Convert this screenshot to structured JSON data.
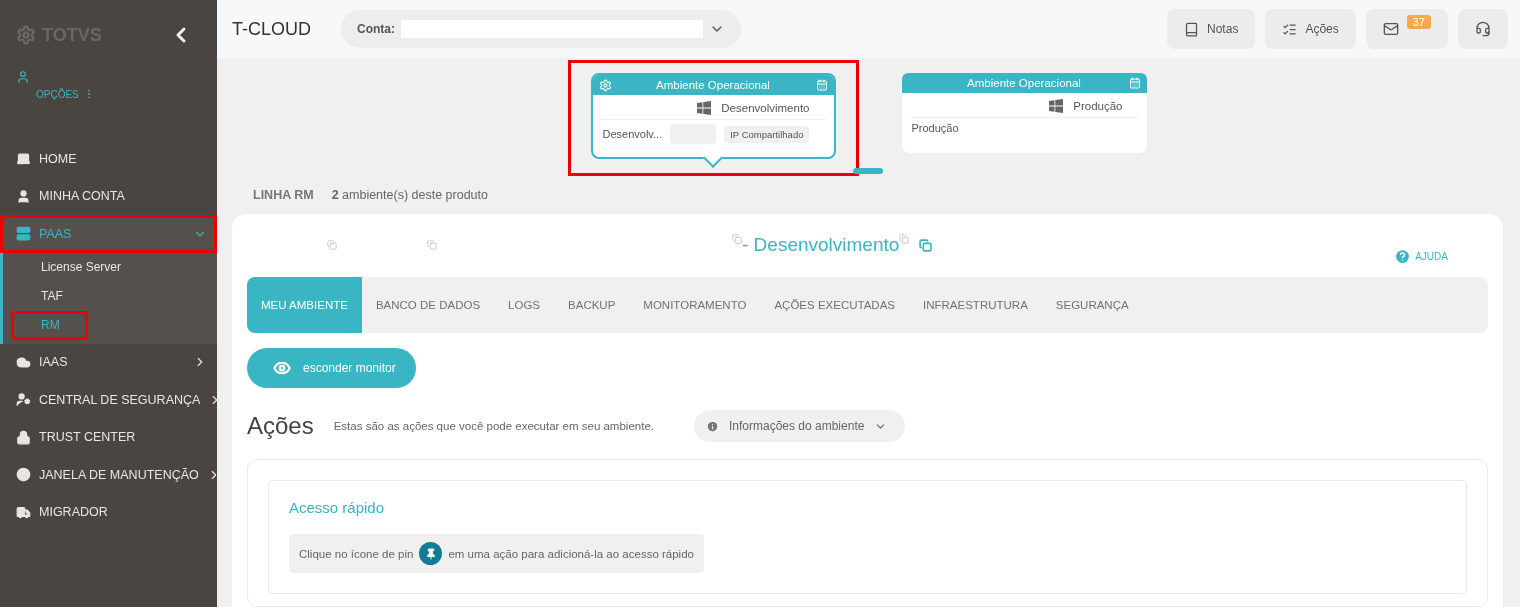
{
  "sidebar": {
    "logo": "TOTVS",
    "options_label": "OPÇÕES",
    "items": [
      {
        "label": "HOME",
        "expandable": false,
        "expanded": false,
        "highlighted": false
      },
      {
        "label": "MINHA CONTA",
        "expandable": false,
        "expanded": false,
        "highlighted": false
      },
      {
        "label": "PAAS",
        "expandable": true,
        "expanded": true,
        "highlighted": true,
        "children": [
          {
            "label": "License Server",
            "selected": false,
            "highlighted": false
          },
          {
            "label": "TAF",
            "selected": false,
            "highlighted": false
          },
          {
            "label": "RM",
            "selected": true,
            "highlighted": true
          }
        ]
      },
      {
        "label": "IAAS",
        "expandable": true,
        "expanded": false,
        "highlighted": false
      },
      {
        "label": "CENTRAL DE SEGURANÇA",
        "expandable": true,
        "expanded": false,
        "highlighted": false
      },
      {
        "label": "TRUST CENTER",
        "expandable": false,
        "expanded": false,
        "highlighted": false
      },
      {
        "label": "JANELA DE MANUTENÇÃO",
        "expandable": true,
        "expanded": false,
        "highlighted": false
      },
      {
        "label": "MIGRADOR",
        "expandable": false,
        "expanded": false,
        "highlighted": false
      }
    ]
  },
  "topbar": {
    "title": "T-CLOUD",
    "account_label": "Conta:",
    "notes": "Notas",
    "actions": "Ações",
    "messages_badge": "37"
  },
  "env_cards": [
    {
      "title": "Ambiente Operacional",
      "name": "Desenvolvimento",
      "detail": "Desenvolv...",
      "ip_label": "IP Compartilhado",
      "selected": true,
      "highlighted": true
    },
    {
      "title": "Ambiente Operacional",
      "name": "Produção",
      "detail": "Produção",
      "selected": false,
      "highlighted": false
    }
  ],
  "product": {
    "line": "LINHA RM",
    "summary": "**2** ambiente(s) deste produto"
  },
  "panel": {
    "title": "- Desenvolvimento",
    "help": "AJUDA",
    "tabs": [
      {
        "label": "MEU AMBIENTE",
        "selected": true
      },
      {
        "label": "BANCO DE DADOS",
        "selected": false
      },
      {
        "label": "LOGS",
        "selected": false
      },
      {
        "label": "BACKUP",
        "selected": false
      },
      {
        "label": "MONITORAMENTO",
        "selected": false
      },
      {
        "label": "AÇÕES EXECUTADAS",
        "selected": false
      },
      {
        "label": "INFRAESTRUTURA",
        "selected": false
      },
      {
        "label": "SEGURANÇA",
        "selected": false
      }
    ],
    "monitor_button": "esconder monitor",
    "actions_title": "Ações",
    "actions_description": "Estas são as ações que você pode executar em seu ambiente.",
    "info_dropdown": "Informações do ambiente",
    "quick_access": {
      "title": "Acesso rápido",
      "hint_before": "Clique no ícone de pin",
      "hint_after": "em uma ação para adicioná-la ao acesso rápido"
    }
  }
}
